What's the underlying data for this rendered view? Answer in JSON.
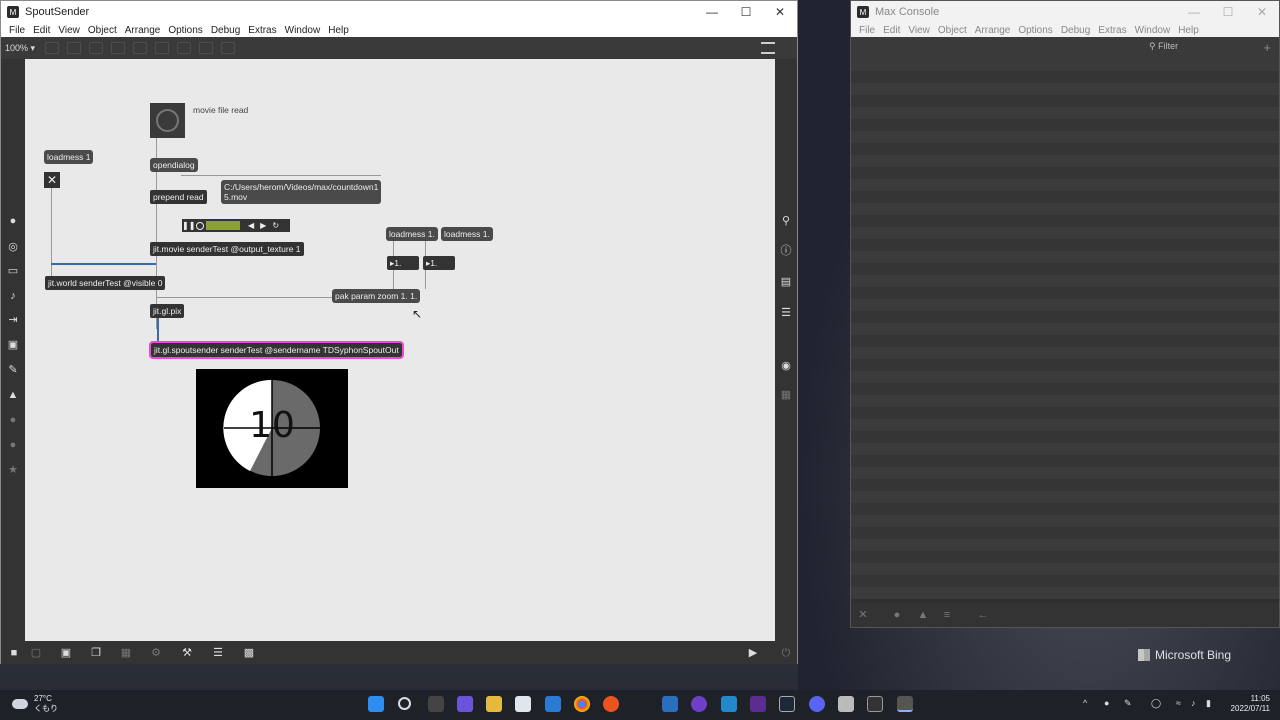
{
  "main_window": {
    "title": "SpoutSender",
    "menu": [
      "File",
      "Edit",
      "View",
      "Object",
      "Arrange",
      "Options",
      "Debug",
      "Extras",
      "Window",
      "Help"
    ],
    "zoom": "100% ▾"
  },
  "patch": {
    "comment_movie": "movie file read",
    "loadmess_left": "loadmess 1",
    "opendialog": "opendialog",
    "filepath_line1": "C:/Users/herom/Videos/max/countdown1",
    "filepath_line2": "5.mov",
    "prepend": "prepend read",
    "jit_movie": "jit.movie senderTest @output_texture 1",
    "jit_world": "jit.world senderTest @visible 0",
    "loadmess_a": "loadmess 1.",
    "loadmess_b": "loadmess 1.",
    "num_a": "1.",
    "num_b": "1.",
    "pak": "pak param zoom 1. 1.",
    "jit_gl_pix": "jit.gl.pix",
    "spoutsender": "jit.gl.spoutsender senderTest @sendername TDSyphonSpoutOut",
    "countdown_number": "10"
  },
  "console_window": {
    "title": "Max Console",
    "menu": [
      "File",
      "Edit",
      "View",
      "Object",
      "Arrange",
      "Options",
      "Debug",
      "Extras",
      "Window",
      "Help"
    ],
    "filter_placeholder": "Filter"
  },
  "desktop": {
    "bing_label": "Microsoft Bing"
  },
  "taskbar": {
    "temperature": "27°C",
    "weather": "くもり",
    "time": "11:05",
    "date": "2022/07/11"
  },
  "colors": {
    "selection": "#e84bd3",
    "canvas": "#e9e9e9",
    "object": "#333333",
    "toggle_green": "#8aa13a"
  }
}
